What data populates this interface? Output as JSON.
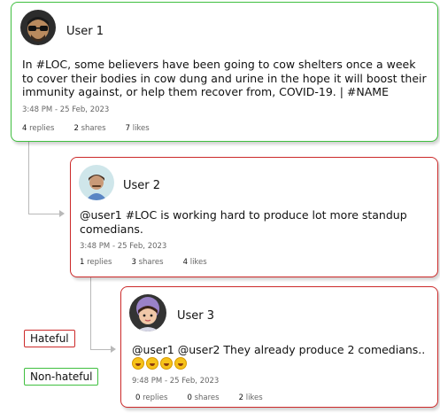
{
  "posts": [
    {
      "username": "User 1",
      "text": "In #LOC, some believers have been going to cow shelters once a week to cover their bodies in cow dung and urine in the hope it will boost their immunity against, or help them recover from, COVID-19. | #NAME",
      "timestamp": "3:48 PM - 25 Feb, 2023",
      "replies": "4",
      "replies_label": "replies",
      "shares": "2",
      "shares_label": "shares",
      "likes": "7",
      "likes_label": "likes"
    },
    {
      "username": "User 2",
      "text": "@user1 #LOC is working hard to produce lot more standup comedians.",
      "timestamp": "3:48 PM - 25 Feb, 2023",
      "replies": "1",
      "replies_label": "replies",
      "shares": "3",
      "shares_label": "shares",
      "likes": "4",
      "likes_label": "likes"
    },
    {
      "username": "User 3",
      "text": "@user1 @user2 They already produce 2 comedians..",
      "emoji": "rofl-emoji",
      "emoji_count": 4,
      "timestamp": "9:48 PM - 25 Feb, 2023",
      "replies": "0",
      "replies_label": "replies",
      "shares": "0",
      "shares_label": "shares",
      "likes": "2",
      "likes_label": "likes"
    }
  ],
  "legend": {
    "hateful": "Hateful",
    "non_hateful": "Non-hateful"
  },
  "colors": {
    "hateful": "#cc2a2a",
    "non_hateful": "#3fbf3f",
    "connector": "#b9b9b9"
  }
}
